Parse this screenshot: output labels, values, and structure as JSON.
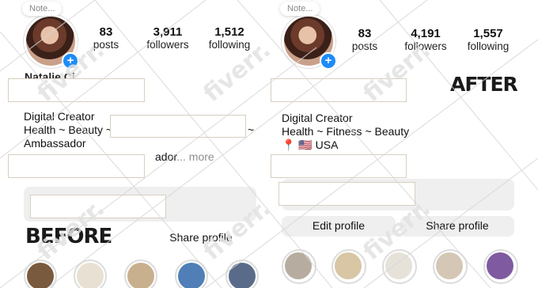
{
  "before": {
    "note_label": "Note...",
    "stats": [
      {
        "num": "83",
        "label": "posts"
      },
      {
        "num": "3,911",
        "label": "followers"
      },
      {
        "num": "1,512",
        "label": "following"
      }
    ],
    "name_partial": "Natalie Ci...",
    "bio_line1": "Digital Creator",
    "bio_line2a": "Health ~ Beauty ~",
    "bio_line2b": "~",
    "bio_line3": "Ambassador",
    "bio_line4": "ador",
    "more_label": "... more",
    "big_label": "BEFORE",
    "share_label": "Share profile",
    "highlight_colors": [
      "#7a5a3e",
      "#e8e0d2",
      "#c8b08e",
      "#4f7fb6",
      "#5a6b8a"
    ]
  },
  "after": {
    "note_label": "Note...",
    "stats": [
      {
        "num": "83",
        "label": "posts"
      },
      {
        "num": "4,191",
        "label": "followers"
      },
      {
        "num": "1,557",
        "label": "following"
      }
    ],
    "bio_line1": "Digital Creator",
    "bio_line2": "Health ~ Fitness ~ Beauty",
    "bio_line3": "📍 🇺🇸 USA",
    "big_label": "AFTER",
    "edit_label": "Edit profile",
    "share_label": "Share profile",
    "highlight_colors": [
      "#b6ada0",
      "#d8c6a4",
      "#e6e2da",
      "#d4c7b5",
      "#7f5aa0"
    ]
  },
  "watermark_text": "fiverr."
}
